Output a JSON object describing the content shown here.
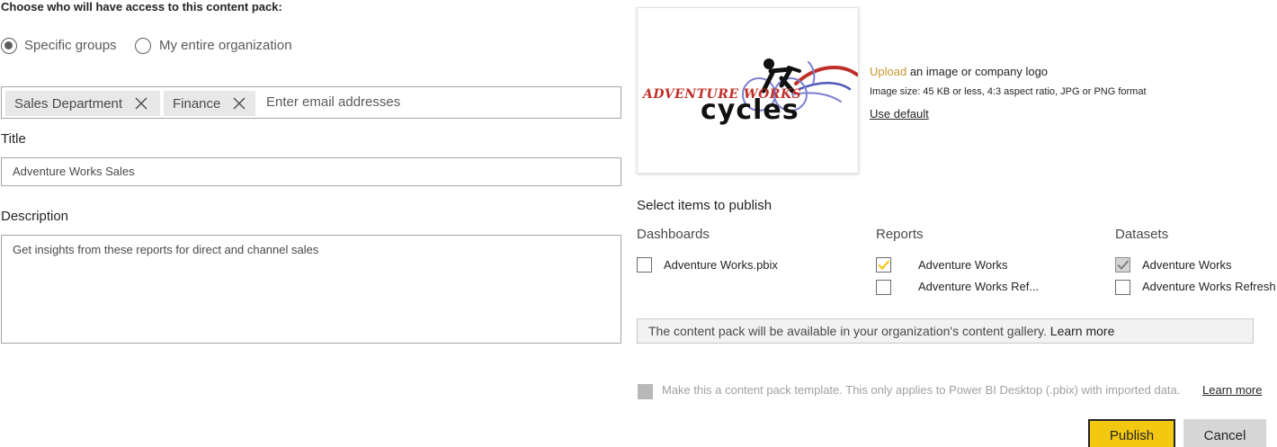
{
  "access": {
    "heading": "Choose who will have access to this content pack:",
    "option_specific": "Specific groups",
    "option_entire": "My entire organization",
    "selected": "Specific groups",
    "chips": [
      {
        "label": "Sales Department"
      },
      {
        "label": "Finance"
      }
    ],
    "email_placeholder": "Enter email addresses"
  },
  "title": {
    "label": "Title",
    "value": "Adventure Works Sales"
  },
  "description": {
    "label": "Description",
    "value": "Get insights from these reports for direct and channel sales"
  },
  "logo": {
    "brand_line1": "ADVENTURE WORKS",
    "brand_line2": "cycles",
    "upload_link": "Upload",
    "upload_text": "an image or company logo",
    "size_hint": "Image size: 45 KB or less, 4:3 aspect ratio, JPG or PNG format",
    "use_default": "Use default",
    "accent_color": "#c8962e"
  },
  "items": {
    "heading": "Select items to publish",
    "dashboards": {
      "label": "Dashboards",
      "entries": [
        {
          "name": "Adventure Works.pbix",
          "checked": false
        }
      ]
    },
    "reports": {
      "label": "Reports",
      "entries": [
        {
          "name": "Adventure Works",
          "checked": true
        },
        {
          "name": "Adventure Works Ref...",
          "checked": false
        }
      ]
    },
    "datasets": {
      "label": "Datasets",
      "entries": [
        {
          "name": "Adventure Works",
          "checked": true,
          "auto": true
        },
        {
          "name": "Adventure Works Refresh",
          "checked": false
        }
      ]
    }
  },
  "gallery_note": {
    "text": "The content pack will be available in your organization's content gallery.",
    "link": "Learn more"
  },
  "template": {
    "text": "Make this a content pack template. This only applies to Power BI Desktop (.pbix) with imported data.",
    "link": "Learn more"
  },
  "buttons": {
    "publish": "Publish",
    "cancel": "Cancel",
    "publish_color": "#f2c811"
  }
}
